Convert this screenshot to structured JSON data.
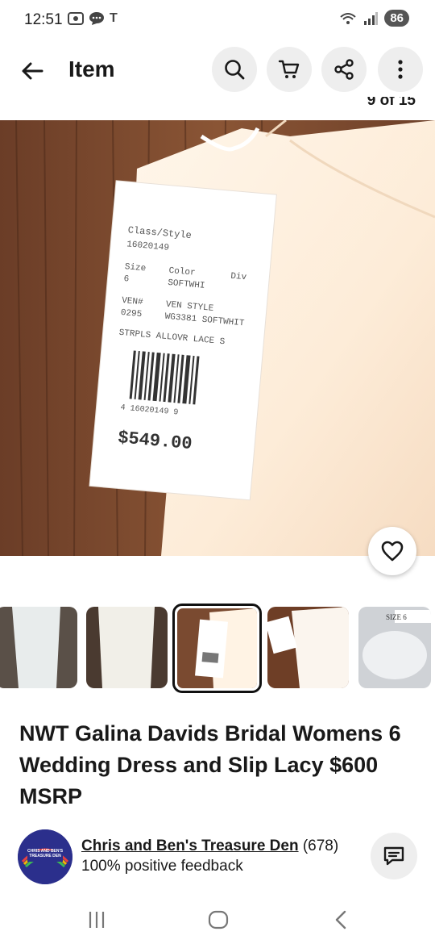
{
  "status_bar": {
    "time": "12:51",
    "battery": "86",
    "carrier_glyph": "T"
  },
  "header": {
    "title": "Item",
    "icons": [
      "back-arrow-icon",
      "search-icon",
      "cart-icon",
      "share-icon",
      "more-vertical-icon"
    ]
  },
  "gallery": {
    "counter": "9 of 15",
    "tag": {
      "line1": "Class/Style",
      "line2": "16020149",
      "size_label": "Size",
      "size_value": "6",
      "color_label": "Color",
      "color_value": "SOFTWHI",
      "div_label": "Div",
      "vendor_label": "VEN#",
      "vendor_value": "0295",
      "ven_style_label": "VEN STYLE",
      "ven_style_value": "WG3381 SOFTWHIT",
      "desc": "STRPLS ALLOVR LACE S",
      "barcode_number": "4 16020149 9",
      "price": "$549.00"
    },
    "thumb_selected_index": 2,
    "thumb_labels": {
      "size_thumb": "SIZE 6"
    }
  },
  "item": {
    "title": "NWT Galina Davids Bridal Womens 6 Wedding Dress and Slip Lacy $600 MSRP"
  },
  "seller": {
    "name": "Chris and Ben's Treasure Den",
    "count": "(678)",
    "feedback": "100% positive feedback",
    "avatar_text": "CHRIS AND BEN'S TREASURE DEN"
  },
  "colors": {
    "text": "#191919",
    "circle_button_bg": "#eeeeee",
    "avatar_bg": "#2b2f8c"
  }
}
